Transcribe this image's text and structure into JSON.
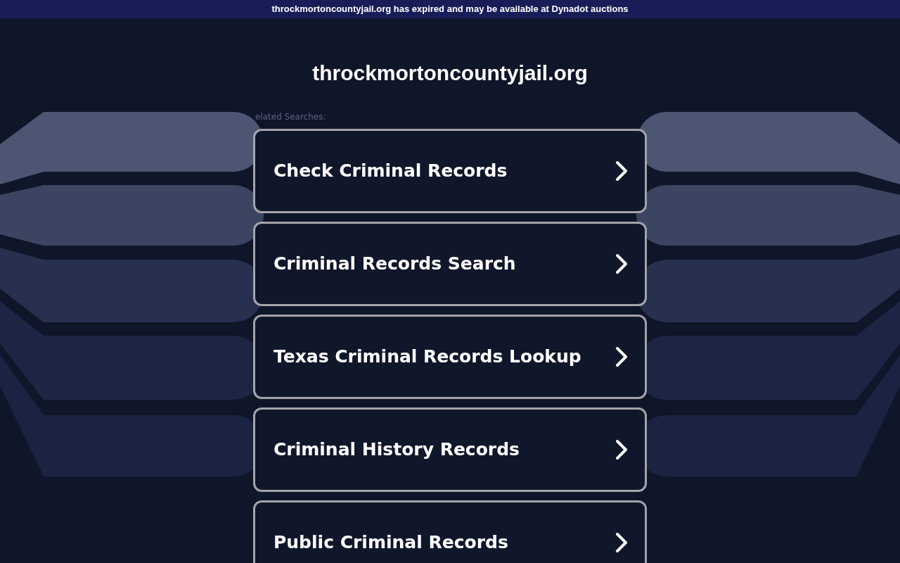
{
  "banner": {
    "text": "throckmortoncountyjail.org has expired and may be available at Dynadot auctions"
  },
  "site_title": "throckmortoncountyjail.org",
  "related_label": "elated Searches:",
  "links": [
    {
      "label": "Check Criminal Records"
    },
    {
      "label": "Criminal Records Search"
    },
    {
      "label": "Texas Criminal Records Lookup"
    },
    {
      "label": "Criminal History Records"
    },
    {
      "label": "Public Criminal Records"
    }
  ]
}
